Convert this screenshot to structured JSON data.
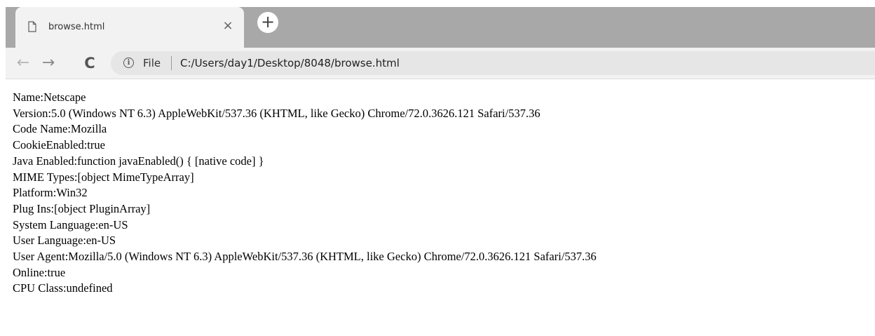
{
  "tab": {
    "title": "browse.html",
    "close_glyph": "×",
    "icon": "page-icon"
  },
  "new_tab_glyph": "+",
  "toolbar": {
    "back_glyph": "←",
    "forward_glyph": "→",
    "reload_glyph": "C",
    "info_glyph": "i",
    "scheme_label": "File",
    "url": "C:/Users/day1/Desktop/8048/browse.html"
  },
  "content": {
    "lines": [
      "Name:Netscape",
      "Version:5.0 (Windows NT 6.3) AppleWebKit/537.36 (KHTML, like Gecko) Chrome/72.0.3626.121 Safari/537.36",
      "Code Name:Mozilla",
      "CookieEnabled:true",
      "Java Enabled:function javaEnabled() { [native code] }",
      "MIME Types:[object MimeTypeArray]",
      "Platform:Win32",
      "Plug Ins:[object PluginArray]",
      "System Language:en-US",
      "User Language:en-US",
      "User Agent:Mozilla/5.0 (Windows NT 6.3) AppleWebKit/537.36 (KHTML, like Gecko) Chrome/72.0.3626.121 Safari/537.36",
      "Online:true",
      "CPU Class:undefined"
    ]
  },
  "colors": {
    "tabstrip": "#a8a8a8",
    "active_tab": "#f2f2f2",
    "omnibox": "#e6e6e6"
  }
}
